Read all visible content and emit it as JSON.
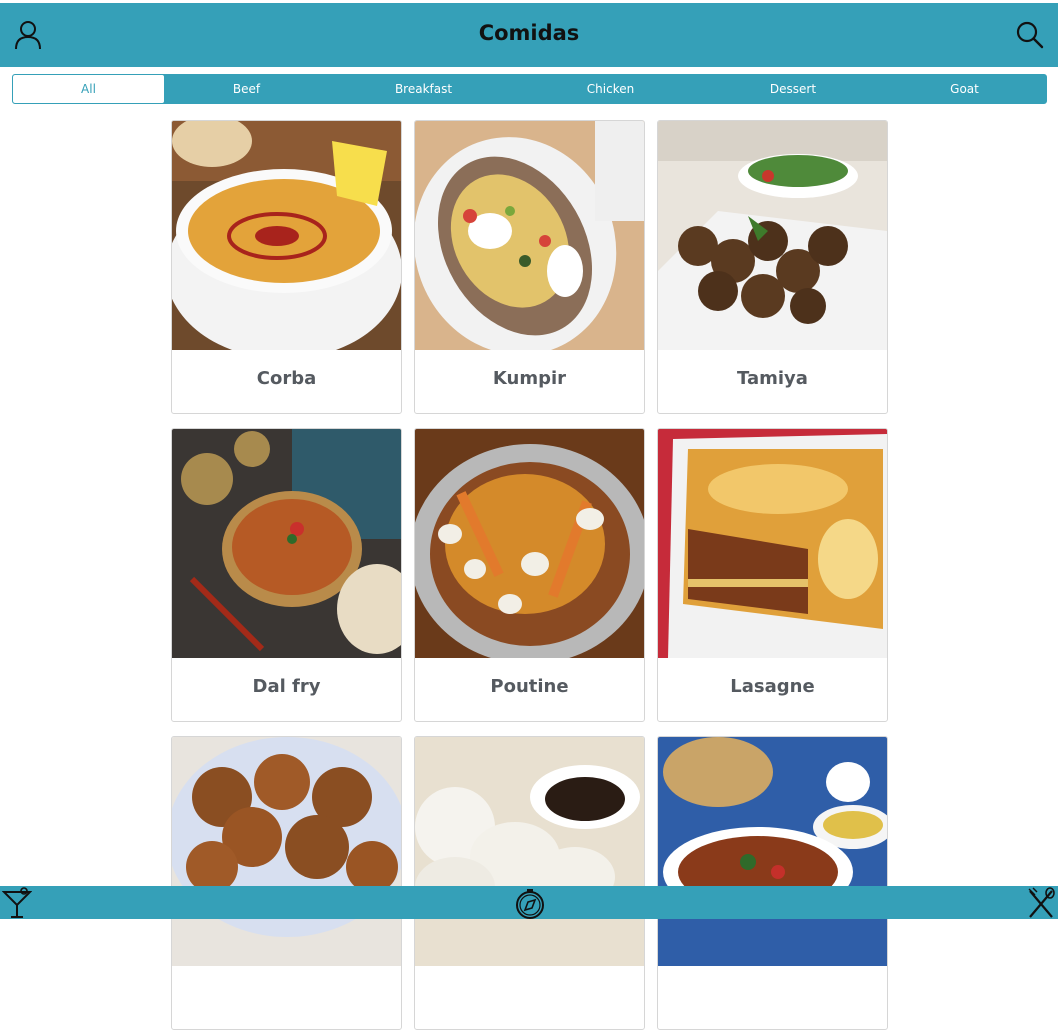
{
  "header": {
    "title": "Comidas"
  },
  "filters": [
    "All",
    "Beef",
    "Breakfast",
    "Chicken",
    "Dessert",
    "Goat"
  ],
  "active_filter": "All",
  "recipes": [
    "Corba",
    "Kumpir",
    "Tamiya",
    "Dal fry",
    "Poutine",
    "Lasagne",
    "",
    "",
    ""
  ],
  "colors": {
    "accent": "#35a0b8",
    "card_text": "#555a60"
  },
  "icons": {
    "header_left": "profile-icon",
    "header_right": "search-icon",
    "footer_left": "drinks-icon",
    "footer_center": "explore-icon",
    "footer_right": "meals-icon"
  }
}
